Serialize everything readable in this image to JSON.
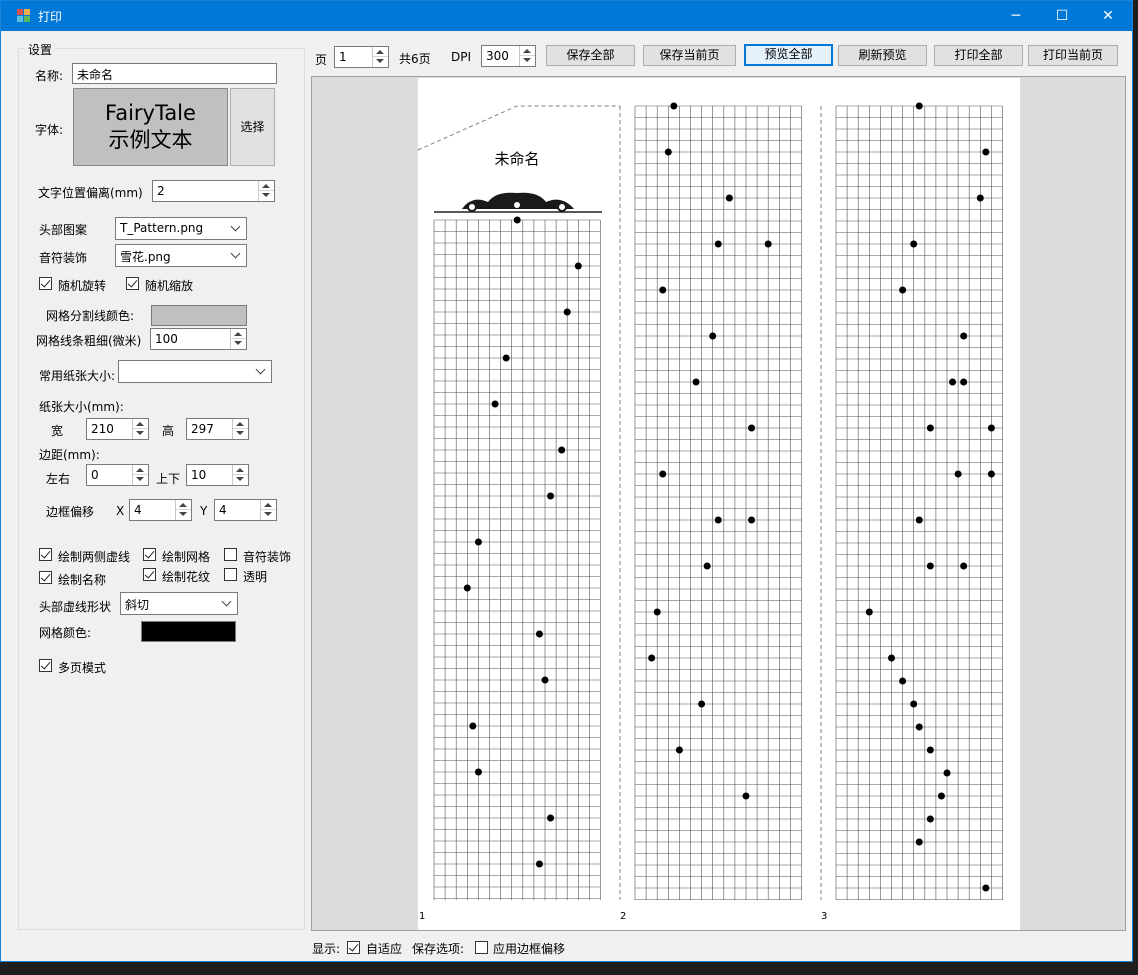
{
  "window": {
    "title": "打印",
    "controls": [
      "─",
      "☐",
      "✕"
    ]
  },
  "settings": {
    "group_title": "设置",
    "name_label": "名称:",
    "name_value": "未命名",
    "font_label": "字体:",
    "font_preview_line1": "FairyTale",
    "font_preview_line2": "示例文本",
    "font_select_label": "选择",
    "text_offset_label": "文字位置偏离(mm)",
    "text_offset_value": "2",
    "header_pattern_label": "头部图案",
    "header_pattern_value": "T_Pattern.png",
    "note_decor_label": "音符装饰",
    "note_decor_value": "雪花.png",
    "random_rotate_label": "随机旋转",
    "random_rotate_checked": true,
    "random_scale_label": "随机缩放",
    "random_scale_checked": true,
    "grid_divider_color_label": "网格分割线颜色:",
    "grid_divider_color": "#c0c0c0",
    "grid_line_width_label": "网格线条粗细(微米)",
    "grid_line_width_value": "100",
    "paper_preset_label": "常用纸张大小:",
    "paper_preset_value": "",
    "paper_size_label": "纸张大小(mm):",
    "width_label": "宽",
    "width_value": "210",
    "height_label": "高",
    "height_value": "297",
    "margin_label": "边距(mm):",
    "margin_lr_label": "左右",
    "margin_lr_value": "0",
    "margin_tb_label": "上下",
    "margin_tb_value": "10",
    "border_offset_label": "边框偏移",
    "offset_x_label": "X",
    "offset_x_value": "4",
    "offset_y_label": "Y",
    "offset_y_value": "4",
    "draw_side_dashes_label": "绘制两侧虚线",
    "draw_side_dashes_checked": true,
    "draw_grid_label": "绘制网格",
    "draw_grid_checked": true,
    "note_decor_toggle_label": "音符装饰",
    "note_decor_toggle_checked": false,
    "draw_name_label": "绘制名称",
    "draw_name_checked": true,
    "draw_flourish_label": "绘制花纹",
    "draw_flourish_checked": true,
    "transparent_label": "透明",
    "transparent_checked": false,
    "header_dash_shape_label": "头部虚线形状",
    "header_dash_shape_value": "斜切",
    "grid_color_label": "网格颜色:",
    "grid_color": "#000000",
    "multipage_label": "多页模式",
    "multipage_checked": true
  },
  "toolbar": {
    "page_label": "页",
    "page_value": "1",
    "total_pages": "共6页",
    "dpi_label": "DPI",
    "dpi_value": "300",
    "save_all": "保存全部",
    "save_current": "保存当前页",
    "preview_all": "预览全部",
    "refresh_preview": "刷新预览",
    "print_all": "打印全部",
    "print_current": "打印当前页"
  },
  "preview": {
    "strip_title": "未命名",
    "strip_numbers": [
      "1",
      "2",
      "3"
    ],
    "strips": [
      {
        "dots": [
          [
            7.5,
            0
          ],
          [
            13,
            2
          ],
          [
            12,
            4
          ],
          [
            6.5,
            6
          ],
          [
            5.5,
            8
          ],
          [
            11.5,
            10
          ],
          [
            10.5,
            12
          ],
          [
            4,
            14
          ],
          [
            3,
            16
          ],
          [
            9.5,
            18
          ],
          [
            10,
            20
          ],
          [
            3.5,
            22
          ],
          [
            4,
            24
          ],
          [
            10.5,
            26
          ],
          [
            9.5,
            28
          ]
        ]
      },
      {
        "dots": [
          [
            3.5,
            0
          ],
          [
            3,
            2
          ],
          [
            8.5,
            4
          ],
          [
            7.5,
            6
          ],
          [
            12,
            6
          ],
          [
            2.5,
            8
          ],
          [
            7,
            10
          ],
          [
            5.5,
            12
          ],
          [
            10.5,
            14
          ],
          [
            2.5,
            16
          ],
          [
            7.5,
            18
          ],
          [
            10.5,
            18
          ],
          [
            6.5,
            20
          ],
          [
            2,
            22
          ],
          [
            1.5,
            24
          ],
          [
            6,
            26
          ],
          [
            4,
            28
          ],
          [
            10,
            30
          ]
        ]
      },
      {
        "dots": [
          [
            7.5,
            0
          ],
          [
            13.5,
            2
          ],
          [
            13,
            4
          ],
          [
            7,
            6
          ],
          [
            6,
            8
          ],
          [
            11.5,
            10
          ],
          [
            10.5,
            12
          ],
          [
            11.5,
            12
          ],
          [
            8.5,
            14
          ],
          [
            14,
            14
          ],
          [
            11,
            16
          ],
          [
            14,
            16
          ],
          [
            7.5,
            18
          ],
          [
            8.5,
            20
          ],
          [
            11.5,
            20
          ],
          [
            3,
            22
          ],
          [
            5,
            24
          ],
          [
            6,
            25
          ],
          [
            7,
            26
          ],
          [
            7.5,
            27
          ],
          [
            8.5,
            28
          ],
          [
            10,
            29
          ],
          [
            9.5,
            30
          ],
          [
            8.5,
            31
          ],
          [
            7.5,
            32
          ],
          [
            13.5,
            34
          ]
        ]
      }
    ]
  },
  "bottom": {
    "display_label": "显示:",
    "fit_label": "自适应",
    "fit_checked": true,
    "save_options_label": "保存选项:",
    "apply_offset_label": "应用边框偏移",
    "apply_offset_checked": false
  }
}
